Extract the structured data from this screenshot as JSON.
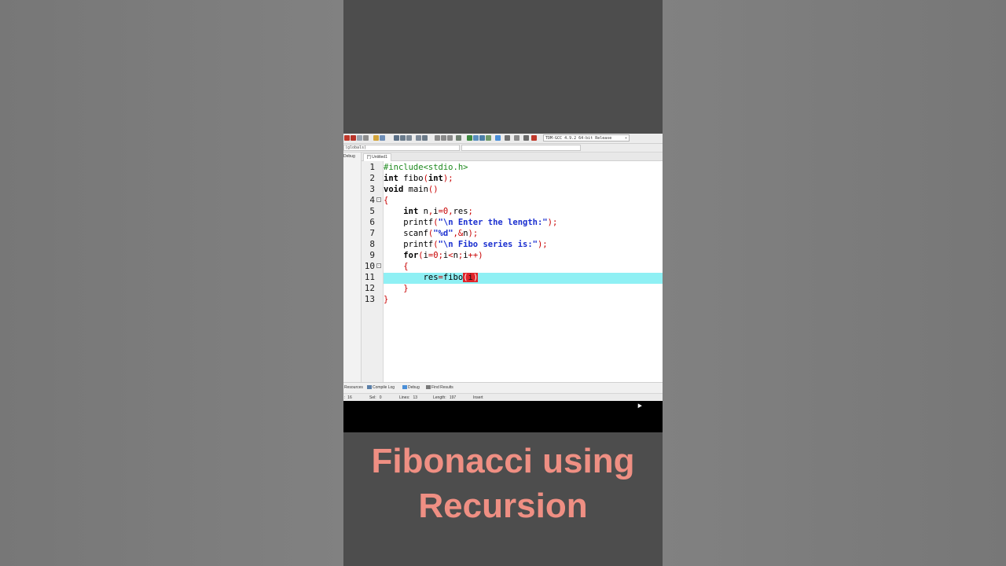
{
  "ide": {
    "compiler_select": "TDM-GCC 4.9.2 64-bit Release",
    "combo_left": "(globals)",
    "left_panel_tab": "Debug",
    "file_tab": "[*] Untitled1",
    "bottom_tabs": [
      "Resources",
      "Compile Log",
      "Debug",
      "Find Results"
    ],
    "status": {
      "col": "16",
      "sel_label": "Sel:",
      "sel_value": "0",
      "lines_label": "Lines:",
      "lines_value": "13",
      "length_label": "Length:",
      "length_value": "197",
      "mode": "Insert"
    },
    "line_numbers": [
      "1",
      "2",
      "3",
      "4",
      "5",
      "6",
      "7",
      "8",
      "9",
      "10",
      "11",
      "12",
      "13"
    ],
    "highlighted_line": 11
  },
  "caption": {
    "line1": "Fibonacci using",
    "line2": "Recursion"
  },
  "colors": {
    "caption": "#ef8f83",
    "highlight": "#8ff0f4",
    "match_bracket": "#e0242a"
  }
}
